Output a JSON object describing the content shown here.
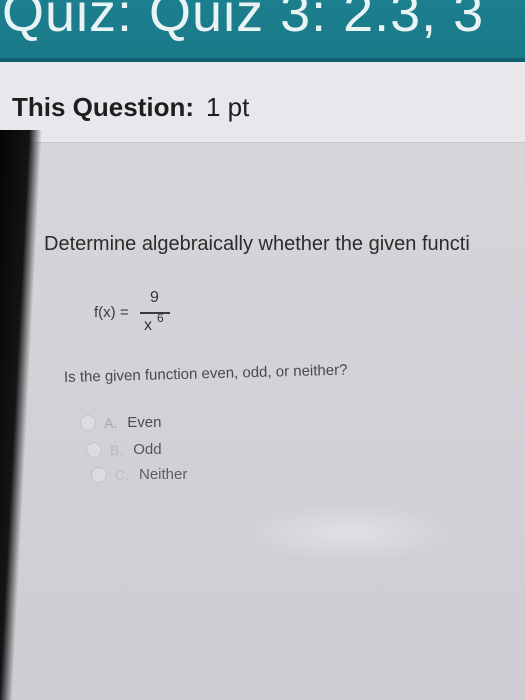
{
  "quiz": {
    "title": "Quiz: Quiz 3: 2.3, 3"
  },
  "question_header": {
    "label": "This Question:",
    "value": "1 pt"
  },
  "question": {
    "prompt": "Determine algebraically whether the given functi",
    "function": {
      "lhs": "f(x) =",
      "numerator": "9",
      "denominator": "x",
      "exponent": "6"
    },
    "sub_question": "Is the given function even, odd, or neither?",
    "options": [
      {
        "letter": "A.",
        "text": "Even"
      },
      {
        "letter": "B.",
        "text": "Odd"
      },
      {
        "letter": "C.",
        "text": "Neither"
      }
    ]
  }
}
